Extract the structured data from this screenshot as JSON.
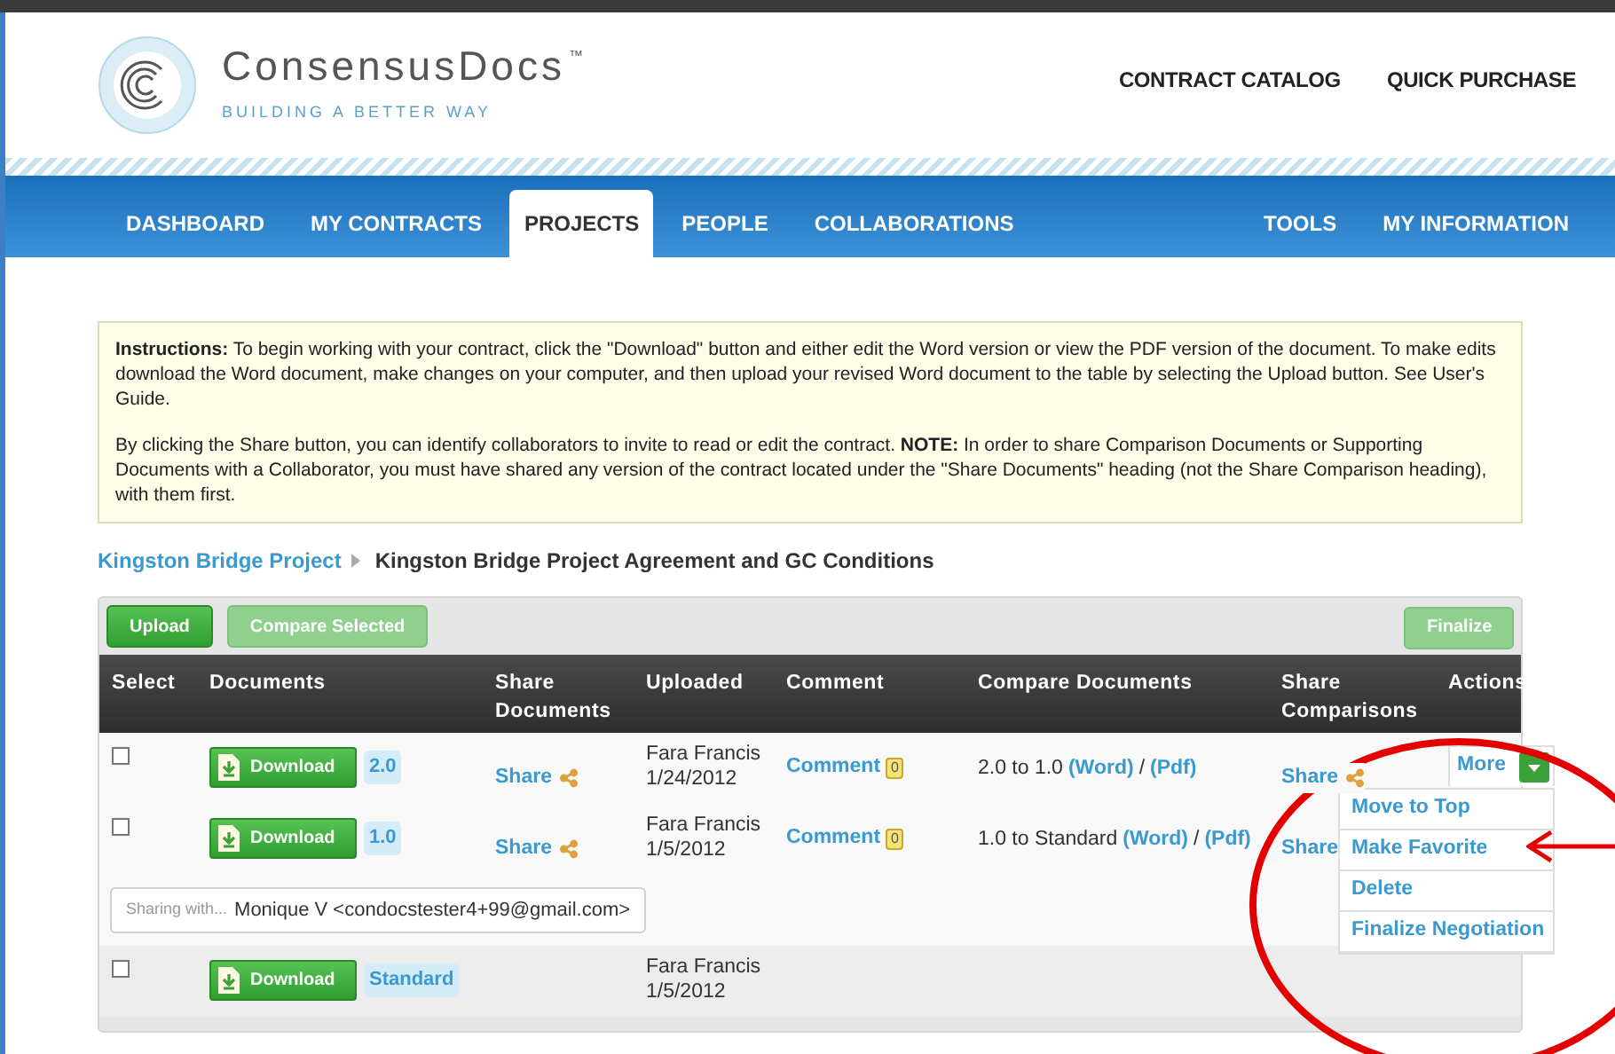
{
  "header": {
    "logo_name": "ConsensusDocs",
    "trademark": "™",
    "tagline": "BUILDING A BETTER WAY",
    "top_links": [
      "CONTRACT CATALOG",
      "QUICK PURCHASE"
    ]
  },
  "nav": {
    "tabs": [
      {
        "label": "DASHBOARD",
        "selected": false
      },
      {
        "label": "MY CONTRACTS",
        "selected": false
      },
      {
        "label": "PROJECTS",
        "selected": true
      },
      {
        "label": "PEOPLE",
        "selected": false
      },
      {
        "label": "COLLABORATIONS",
        "selected": false
      }
    ],
    "right_tabs": [
      {
        "label": "TOOLS",
        "selected": false
      },
      {
        "label": "MY INFORMATION",
        "selected": false
      }
    ]
  },
  "instructions": [
    "**Instructions:** To begin working with your contract, click the \"Download\" button and either edit the Word version or view the PDF version of the document. To make edits download the Word document, make changes on your computer, and then upload your revised Word document to the table by selecting the Upload button. See User's Guide.",
    "By clicking the Share button, you can identify collaborators to invite to read or edit the contract. **NOTE:** In order to share Comparison Documents or Supporting Documents with a Collaborator, you must have shared any version of the contract located under the \"Share Documents\" heading (not the Share Comparison heading), with them first."
  ],
  "breadcrumb": {
    "link": "Kingston Bridge Project",
    "current": "Kingston Bridge Project Agreement and GC Conditions"
  },
  "toolbar": {
    "buttons": [
      {
        "label": "Upload",
        "disabled": false
      },
      {
        "label": "Compare Selected",
        "disabled": true
      }
    ],
    "finalize": {
      "label": "Finalize",
      "disabled": true
    }
  },
  "table": {
    "columns": [
      "Select",
      "Documents",
      "Share Documents",
      "Uploaded",
      "Comment",
      "Compare Documents",
      "Share Comparisons",
      "Actions"
    ],
    "rows": [
      {
        "kind": "document",
        "checked": false,
        "download": "Download",
        "version": "2.0",
        "share": "Share",
        "uploaded_by": "Fara Francis",
        "uploaded_on": "1/24/2012",
        "comment": "Comment",
        "comment_count": "0",
        "compare": {
          "text": "2.0 to 1.0",
          "word": "(Word)",
          "separator": "/",
          "pdf": "(Pdf)"
        },
        "share_comparison": {
          "label": "Share",
          "icon": true
        },
        "actions": {
          "label": "More",
          "expanded": true,
          "menu": [
            "Move to Top",
            "Make Favorite",
            "Delete",
            "Finalize Negotiation"
          ]
        }
      },
      {
        "kind": "document",
        "checked": false,
        "download": "Download",
        "version": "1.0",
        "share": "Share",
        "uploaded_by": "Fara Francis",
        "uploaded_on": "1/5/2012",
        "comment": "Comment",
        "comment_count": "0",
        "compare": {
          "text": "1.0 to Standard",
          "word": "(Word)",
          "separator": "/",
          "pdf": "(Pdf)"
        },
        "share_comparison": {
          "label": "Share",
          "icon": false
        }
      },
      {
        "kind": "sharing",
        "placeholder": "Sharing with...",
        "value": "Monique V <condocstester4+99@gmail.com>"
      },
      {
        "kind": "document",
        "checked": false,
        "download": "Download",
        "version": "Standard",
        "uploaded_by": "Fara Francis",
        "uploaded_on": "1/5/2012"
      }
    ]
  }
}
